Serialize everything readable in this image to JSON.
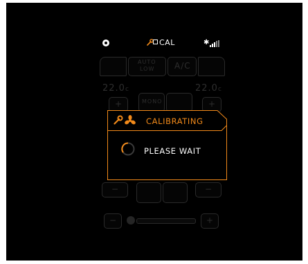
{
  "status_bar": {
    "cal_label": "CAL",
    "icons": [
      "power-icon",
      "wrench-icon",
      "square-icon",
      "bluetooth-icon",
      "signal-icon"
    ]
  },
  "background_controls": {
    "auto_label_line1": "AUTO",
    "auto_label_line2": "LOW",
    "ac_label": "A/C",
    "left_temp": "22.0",
    "left_temp_unit": "c",
    "right_temp": "22.0",
    "right_temp_unit": "c",
    "plus": "+",
    "minus": "−",
    "mono_label": "MONO"
  },
  "modal": {
    "title": "CALIBRATING",
    "message": "PLEASE WAIT",
    "accent_color": "#f28a1a"
  }
}
